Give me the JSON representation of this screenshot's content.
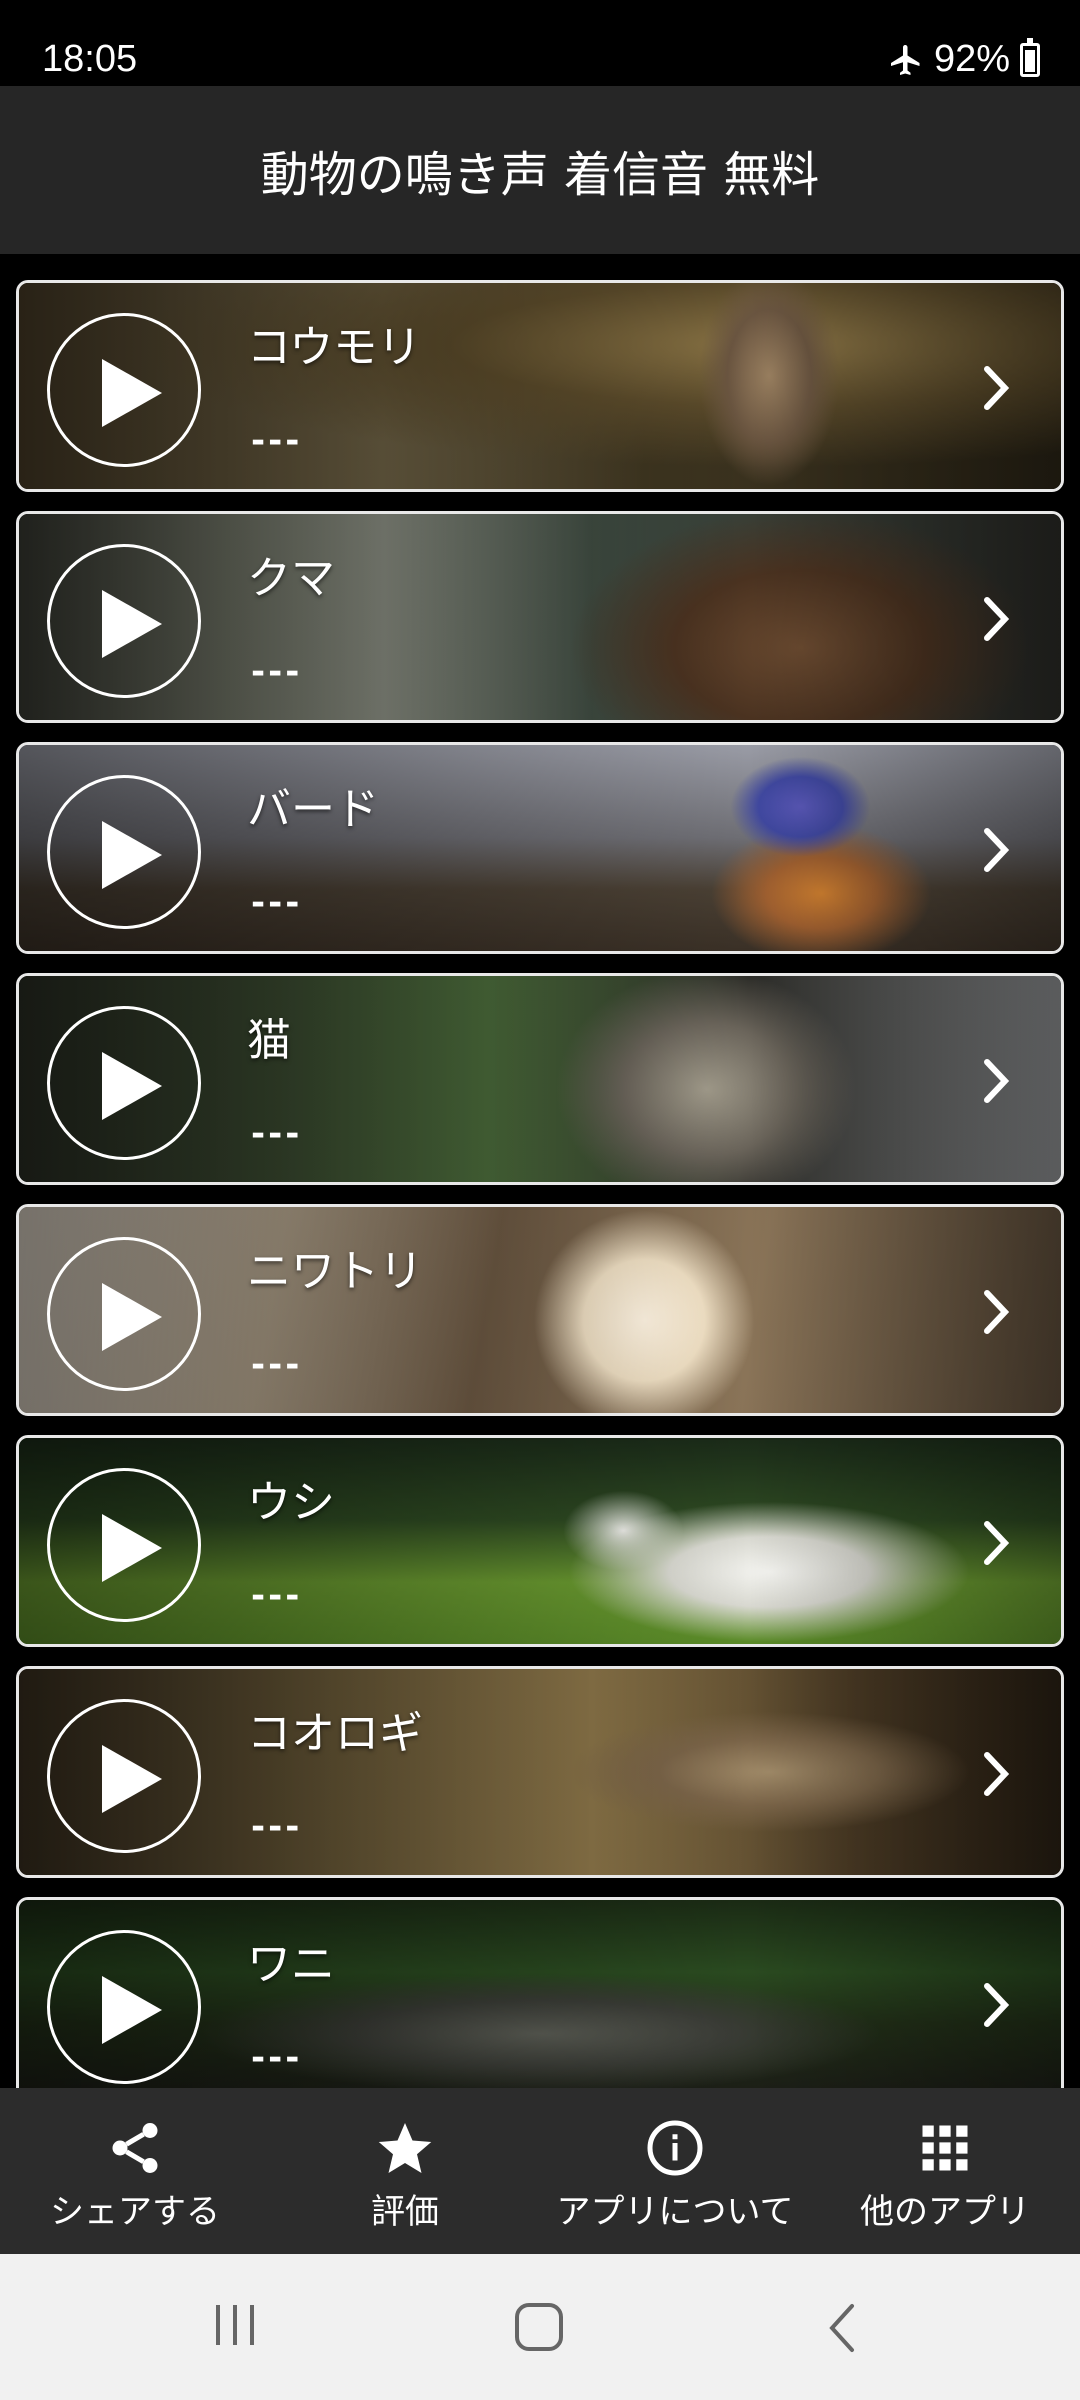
{
  "status": {
    "time": "18:05",
    "battery": "92%",
    "battery_level": 0.92
  },
  "app": {
    "title": "動物の鳴き声 着信音 無料"
  },
  "items": [
    {
      "name": "コウモリ",
      "subtitle": "---"
    },
    {
      "name": "クマ",
      "subtitle": "---"
    },
    {
      "name": "バード",
      "subtitle": "---"
    },
    {
      "name": "猫",
      "subtitle": "---"
    },
    {
      "name": "ニワトリ",
      "subtitle": "---"
    },
    {
      "name": "ウシ",
      "subtitle": "---"
    },
    {
      "name": "コオロギ",
      "subtitle": "---"
    },
    {
      "name": "ワニ",
      "subtitle": "---"
    }
  ],
  "bottom_nav": [
    {
      "label": "シェアする",
      "icon": "share-icon"
    },
    {
      "label": "評価",
      "icon": "star-icon"
    },
    {
      "label": "アプリについて",
      "icon": "info-icon"
    },
    {
      "label": "他のアプリ",
      "icon": "grid-icon"
    }
  ],
  "system_nav": {
    "icons": [
      "recent-apps-icon",
      "home-icon",
      "back-icon"
    ]
  },
  "colors": {
    "app_bar": "#262626",
    "bottom_nav": "#2c2c2c",
    "system_nav": "#f1f1f1",
    "card_border": "#e8e8e8"
  }
}
